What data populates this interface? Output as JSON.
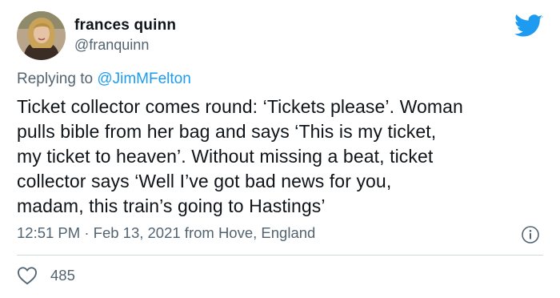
{
  "user": {
    "display_name": "frances quinn",
    "handle": "@franquinn",
    "avatar_icon": "profile-photo"
  },
  "reply": {
    "prefix": "Replying to ",
    "mention": "@JimMFelton"
  },
  "tweet": {
    "text": "Ticket collector comes round: ‘Tickets please’. Woman\npulls bible from her bag and says ‘This is my ticket,\nmy ticket to heaven’. Without missing a beat, ticket\ncollector says ‘Well I’ve got bad news for you,\nmadam, this train’s going to Hastings’",
    "time": "12:51 PM",
    "separator": " · ",
    "date": "Feb 13, 2021",
    "source": " from Hove, England"
  },
  "engagement": {
    "likes": "485"
  },
  "icons": {
    "brand": "twitter-bird-icon",
    "info": "info-icon",
    "like": "heart-icon"
  },
  "colors": {
    "brand_blue": "#1d9bf0",
    "secondary_text": "#536471",
    "primary_text": "#0f1419",
    "divider": "#cfd9de"
  }
}
